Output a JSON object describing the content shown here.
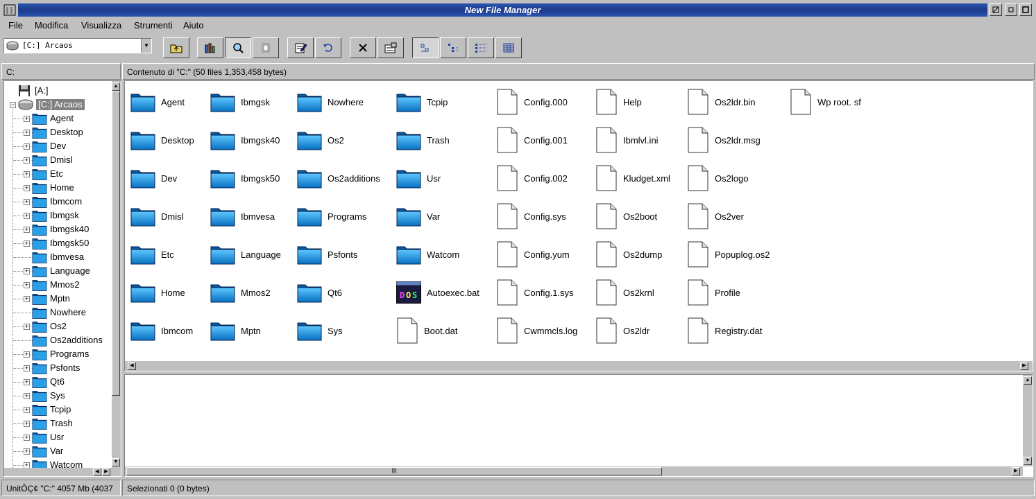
{
  "window": {
    "title": "New File Manager"
  },
  "menubar": [
    {
      "label": "File"
    },
    {
      "label": "Modifica"
    },
    {
      "label": "Visualizza"
    },
    {
      "label": "Strumenti"
    },
    {
      "label": "Aiuto"
    }
  ],
  "toolbar": {
    "drive_value": "[C:] Arcaos",
    "buttons": [
      "parent-folder",
      "bar-chart",
      "find",
      "window",
      "edit",
      "undo",
      "delete",
      "properties",
      "view-icons",
      "view-tree",
      "view-details",
      "view-list"
    ]
  },
  "left_header": "C:",
  "right_header": "Contenuto di  \"C:\"  (50 files  1,353,458 bytes)",
  "tree": {
    "floppy": "[A:]",
    "drive": "[C:] Arcaos",
    "folders": [
      "Agent",
      "Desktop",
      "Dev",
      "Dmisl",
      "Etc",
      "Home",
      "Ibmcom",
      "Ibmgsk",
      "Ibmgsk40",
      "Ibmgsk50",
      "Ibmvesa",
      "Language",
      "Mmos2",
      "Mptn",
      "Nowhere",
      "Os2",
      "Os2additions",
      "Programs",
      "Psfonts",
      "Qt6",
      "Sys",
      "Tcpip",
      "Trash",
      "Usr",
      "Var",
      "Watcom"
    ],
    "no_expander": [
      "Ibmvesa",
      "Nowhere",
      "Os2additions"
    ]
  },
  "files": {
    "columns": [
      [
        {
          "n": "Agent",
          "t": "folder"
        },
        {
          "n": "Desktop",
          "t": "folder"
        },
        {
          "n": "Dev",
          "t": "folder"
        },
        {
          "n": "Dmisl",
          "t": "folder"
        },
        {
          "n": "Etc",
          "t": "folder"
        },
        {
          "n": "Home",
          "t": "folder"
        },
        {
          "n": "Ibmcom",
          "t": "folder"
        }
      ],
      [
        {
          "n": "Ibmgsk",
          "t": "folder"
        },
        {
          "n": "Ibmgsk40",
          "t": "folder"
        },
        {
          "n": "Ibmgsk50",
          "t": "folder"
        },
        {
          "n": "Ibmvesa",
          "t": "folder"
        },
        {
          "n": "Language",
          "t": "folder"
        },
        {
          "n": "Mmos2",
          "t": "folder"
        },
        {
          "n": "Mptn",
          "t": "folder"
        }
      ],
      [
        {
          "n": "Nowhere",
          "t": "folder"
        },
        {
          "n": "Os2",
          "t": "folder"
        },
        {
          "n": "Os2additions",
          "t": "folder"
        },
        {
          "n": "Programs",
          "t": "folder"
        },
        {
          "n": "Psfonts",
          "t": "folder"
        },
        {
          "n": "Qt6",
          "t": "folder"
        },
        {
          "n": "Sys",
          "t": "folder"
        }
      ],
      [
        {
          "n": "Tcpip",
          "t": "folder"
        },
        {
          "n": "Trash",
          "t": "folder"
        },
        {
          "n": "Usr",
          "t": "folder"
        },
        {
          "n": "Var",
          "t": "folder"
        },
        {
          "n": "Watcom",
          "t": "folder"
        },
        {
          "n": "Autoexec.bat",
          "t": "dos"
        },
        {
          "n": "Boot.dat",
          "t": "file"
        }
      ],
      [
        {
          "n": "Config.000",
          "t": "file"
        },
        {
          "n": "Config.001",
          "t": "file"
        },
        {
          "n": "Config.002",
          "t": "file"
        },
        {
          "n": "Config.sys",
          "t": "file"
        },
        {
          "n": "Config.yum",
          "t": "file"
        },
        {
          "n": "Config.1.sys",
          "t": "file"
        },
        {
          "n": "Cwmmcls.log",
          "t": "file"
        }
      ],
      [
        {
          "n": "Help",
          "t": "file"
        },
        {
          "n": "Ibmlvl.ini",
          "t": "file"
        },
        {
          "n": "Kludget.xml",
          "t": "file"
        },
        {
          "n": "Os2boot",
          "t": "file"
        },
        {
          "n": "Os2dump",
          "t": "file"
        },
        {
          "n": "Os2krnl",
          "t": "file"
        },
        {
          "n": "Os2ldr",
          "t": "file"
        }
      ],
      [
        {
          "n": "Os2ldr.bin",
          "t": "file"
        },
        {
          "n": "Os2ldr.msg",
          "t": "file"
        },
        {
          "n": "Os2logo",
          "t": "file"
        },
        {
          "n": "Os2ver",
          "t": "file"
        },
        {
          "n": "Popuplog.os2",
          "t": "file"
        },
        {
          "n": "Profile",
          "t": "file"
        },
        {
          "n": "Registry.dat",
          "t": "file"
        }
      ],
      [
        {
          "n": "Wp root. sf",
          "t": "file"
        }
      ]
    ]
  },
  "status_left": "UnitÔÇ¢ \"C:\"  4057 Mb  (4037",
  "status_right": "Selezionati 0 (0 bytes)"
}
